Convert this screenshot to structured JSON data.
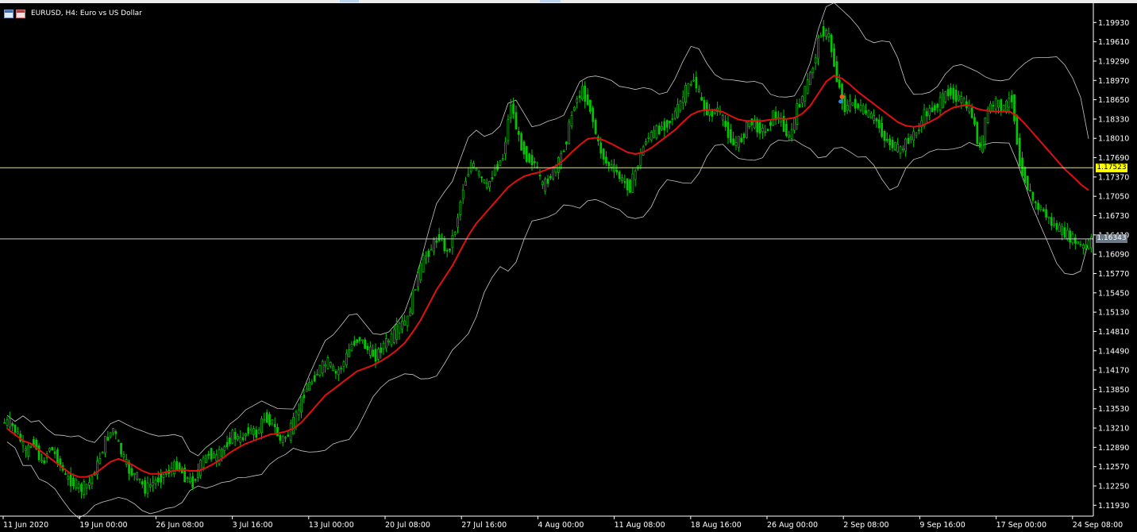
{
  "window": {
    "title": "EURUSD, H4:  Euro vs US Dollar",
    "icons": [
      "chart-window-icon",
      "symbol-flag-icon"
    ]
  },
  "colors": {
    "background": "#000000",
    "candle": "#00c800",
    "moving_average": "#e01010",
    "bollinger_bands": "#c8c8c8",
    "bid_line": "#e8e860",
    "ask_line": "#c8c8c8",
    "axis": "#ffffff"
  },
  "price_axis": {
    "labels": [
      "1.19930",
      "1.19610",
      "1.19290",
      "1.18970",
      "1.18650",
      "1.18330",
      "1.18010",
      "1.17690",
      "1.17370",
      "1.17050",
      "1.16730",
      "1.16410",
      "1.16090",
      "1.15770",
      "1.15450",
      "1.15130",
      "1.14810",
      "1.14490",
      "1.14170",
      "1.13850",
      "1.13530",
      "1.13210",
      "1.12890",
      "1.12570",
      "1.12250",
      "1.11930"
    ]
  },
  "time_axis": {
    "labels": [
      "11 Jun 2020",
      "19 Jun 00:00",
      "26 Jun 08:00",
      "3 Jul 16:00",
      "13 Jul 00:00",
      "20 Jul 08:00",
      "27 Jul 16:00",
      "4 Aug 00:00",
      "11 Aug 08:00",
      "18 Aug 16:00",
      "26 Aug 00:00",
      "2 Sep 08:00",
      "9 Sep 16:00",
      "17 Sep 00:00",
      "24 Sep 08:00"
    ]
  },
  "price_lines": {
    "bid": "1.17523",
    "ask": "1.16343"
  },
  "chart_data": {
    "type": "candlestick",
    "symbol": "EURUSD",
    "timeframe": "H4",
    "ylim": [
      1.1175,
      1.2025
    ],
    "grid": false,
    "indicators": [
      "moving average",
      "Bollinger Bands"
    ],
    "close_series": {
      "name": "",
      "values": [
        1.133,
        1.131,
        1.128,
        1.13,
        1.126,
        1.129,
        1.127,
        1.124,
        1.123,
        1.122,
        1.123,
        1.126,
        1.13,
        1.132,
        1.128,
        1.125,
        1.124,
        1.122,
        1.123,
        1.124,
        1.125,
        1.126,
        1.124,
        1.123,
        1.126,
        1.128,
        1.127,
        1.129,
        1.131,
        1.13,
        1.132,
        1.131,
        1.134,
        1.133,
        1.13,
        1.131,
        1.134,
        1.138,
        1.14,
        1.142,
        1.143,
        1.141,
        1.143,
        1.146,
        1.147,
        1.145,
        1.144,
        1.146,
        1.147,
        1.149,
        1.15,
        1.156,
        1.16,
        1.162,
        1.164,
        1.161,
        1.165,
        1.172,
        1.176,
        1.174,
        1.172,
        1.175,
        1.177,
        1.186,
        1.18,
        1.177,
        1.176,
        1.172,
        1.174,
        1.176,
        1.18,
        1.186,
        1.188,
        1.185,
        1.179,
        1.176,
        1.175,
        1.173,
        1.172,
        1.176,
        1.18,
        1.181,
        1.182,
        1.183,
        1.185,
        1.188,
        1.19,
        1.186,
        1.184,
        1.185,
        1.182,
        1.179,
        1.18,
        1.183,
        1.182,
        1.181,
        1.184,
        1.183,
        1.18,
        1.185,
        1.188,
        1.192,
        1.198,
        1.197,
        1.19,
        1.185,
        1.186,
        1.185,
        1.184,
        1.183,
        1.18,
        1.179,
        1.178,
        1.18,
        1.181,
        1.184,
        1.185,
        1.186,
        1.188,
        1.187,
        1.186,
        1.184,
        1.178,
        1.185,
        1.186,
        1.185,
        1.187,
        1.176,
        1.172,
        1.169,
        1.168,
        1.166,
        1.165,
        1.164,
        1.163,
        1.162,
        1.163
      ]
    },
    "moving_average": {
      "name": "",
      "values": [
        1.132,
        1.131,
        1.13,
        1.1295,
        1.1285,
        1.1275,
        1.1265,
        1.1255,
        1.1245,
        1.124,
        1.124,
        1.1245,
        1.1255,
        1.1265,
        1.127,
        1.1265,
        1.1258,
        1.125,
        1.1245,
        1.1245,
        1.1248,
        1.125,
        1.1252,
        1.125,
        1.125,
        1.1255,
        1.1262,
        1.127,
        1.128,
        1.1288,
        1.1295,
        1.13,
        1.1305,
        1.131,
        1.1312,
        1.1315,
        1.132,
        1.133,
        1.1345,
        1.136,
        1.1375,
        1.1385,
        1.1395,
        1.1405,
        1.1415,
        1.142,
        1.1425,
        1.1432,
        1.144,
        1.145,
        1.1462,
        1.148,
        1.15,
        1.1525,
        1.155,
        1.157,
        1.159,
        1.1615,
        1.164,
        1.166,
        1.1675,
        1.169,
        1.1705,
        1.172,
        1.173,
        1.1738,
        1.1742,
        1.1745,
        1.175,
        1.1755,
        1.1765,
        1.1778,
        1.179,
        1.18,
        1.1802,
        1.1798,
        1.1792,
        1.1785,
        1.1778,
        1.1775,
        1.1778,
        1.1785,
        1.1795,
        1.1805,
        1.1815,
        1.1828,
        1.184,
        1.1846,
        1.1848,
        1.1848,
        1.1845,
        1.1838,
        1.1832,
        1.183,
        1.183,
        1.183,
        1.1832,
        1.1834,
        1.1833,
        1.1835,
        1.1842,
        1.1855,
        1.1875,
        1.1895,
        1.1905,
        1.19,
        1.189,
        1.1878,
        1.1868,
        1.1858,
        1.1848,
        1.1838,
        1.1828,
        1.1822,
        1.182,
        1.1822,
        1.1828,
        1.1835,
        1.1845,
        1.1852,
        1.1855,
        1.1856,
        1.185,
        1.1847,
        1.1846,
        1.1845,
        1.1846,
        1.1838,
        1.1825,
        1.181,
        1.1795,
        1.178,
        1.1765,
        1.175,
        1.1738,
        1.1725,
        1.1715
      ]
    }
  }
}
